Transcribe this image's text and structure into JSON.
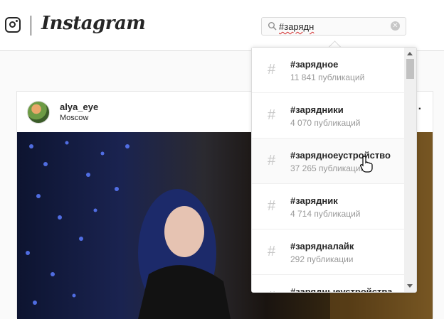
{
  "header": {
    "brand": "Instagram",
    "search": {
      "value": "#зарядн",
      "clear_icon": "clear-icon"
    }
  },
  "post": {
    "username": "alya_eye",
    "location": "Moscow",
    "more_label": "···"
  },
  "dropdown": {
    "results": [
      {
        "tag": "#зарядное",
        "count": "11 841 публикаций"
      },
      {
        "tag": "#зарядники",
        "count": "4 070 публикаций"
      },
      {
        "tag": "#зарядноеустройство",
        "count": "37 265 публикаций"
      },
      {
        "tag": "#зарядник",
        "count": "4 714 публикаций"
      },
      {
        "tag": "#зарядналайк",
        "count": "292 публикации"
      },
      {
        "tag": "#зарядныеустройства",
        "count": ""
      }
    ]
  },
  "colors": {
    "border": "#dbdbdb",
    "text": "#262626",
    "muted": "#999999",
    "background": "#fafafa"
  }
}
